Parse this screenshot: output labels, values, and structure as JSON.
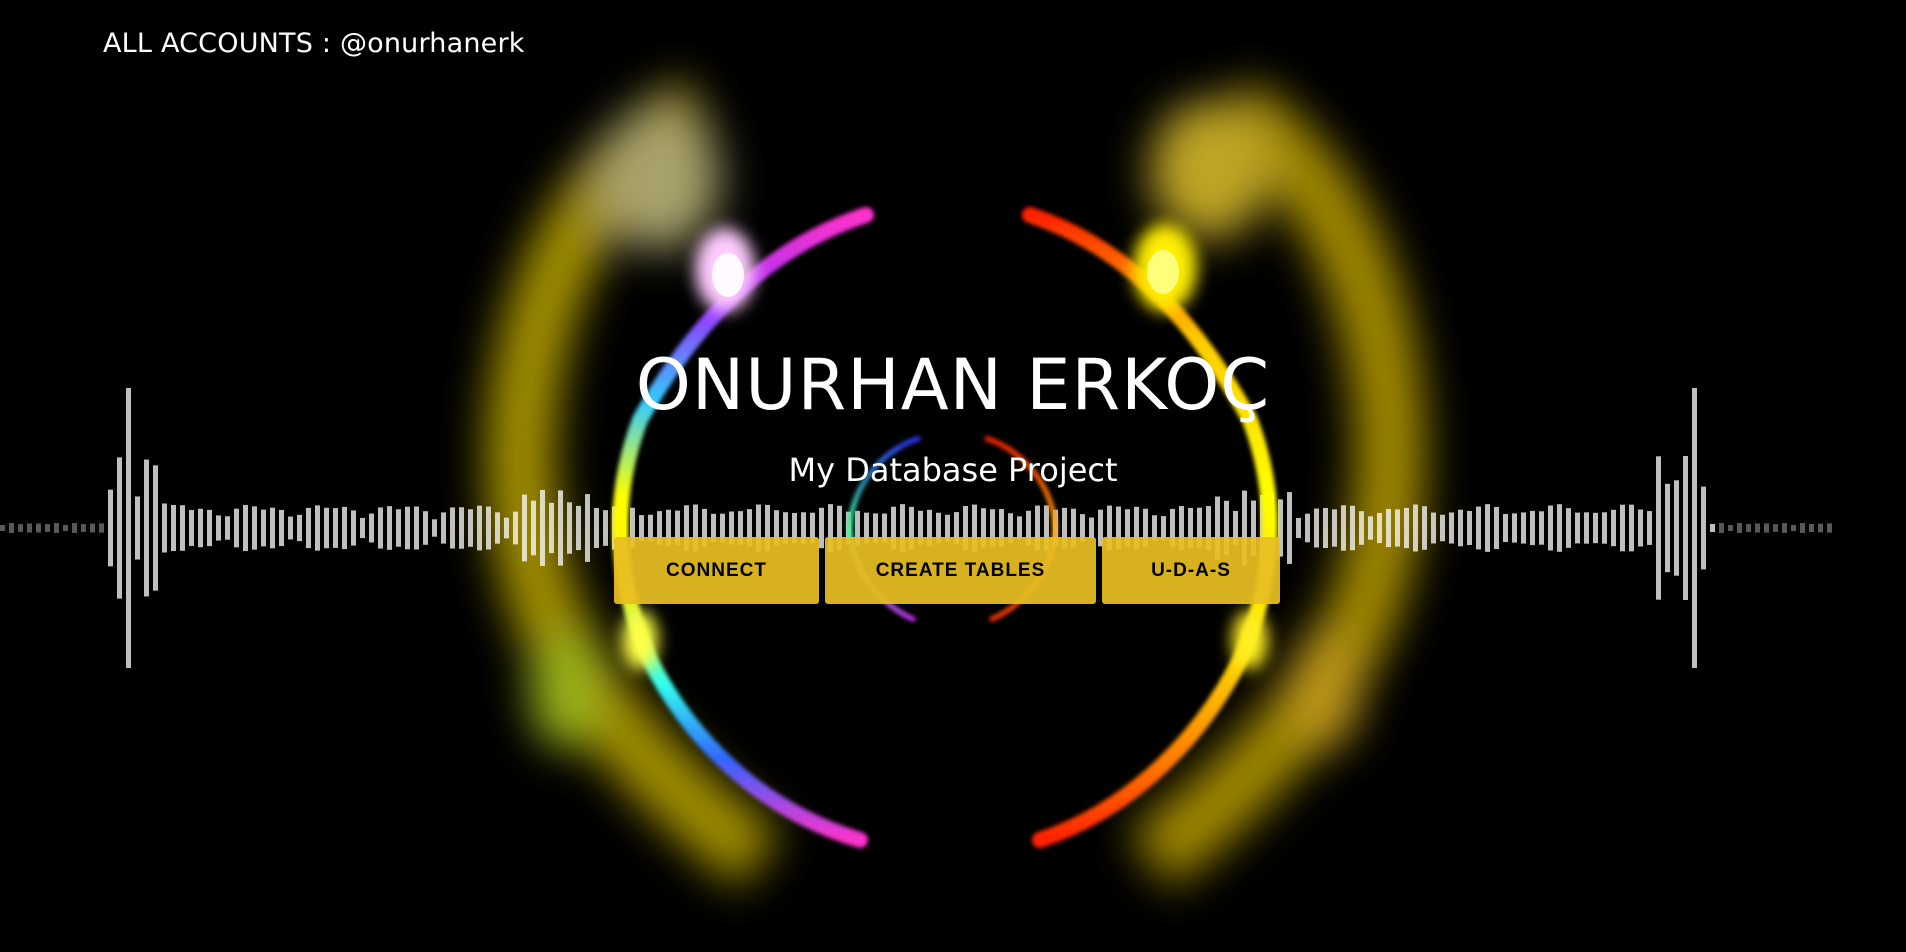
{
  "header": {
    "accounts_link": "ALL ACCOUNTS : @onurhanerk"
  },
  "hero": {
    "title": "ONURHAN ERKOÇ",
    "subtitle": "My Database Project"
  },
  "buttons": {
    "connect": "CONNECT",
    "create_tables": "CREATE TABLES",
    "udas": "U-D-A-S"
  },
  "colors": {
    "background": "#000000",
    "button": "#e8be22",
    "button_text": "#000000",
    "text": "#ffffff"
  }
}
